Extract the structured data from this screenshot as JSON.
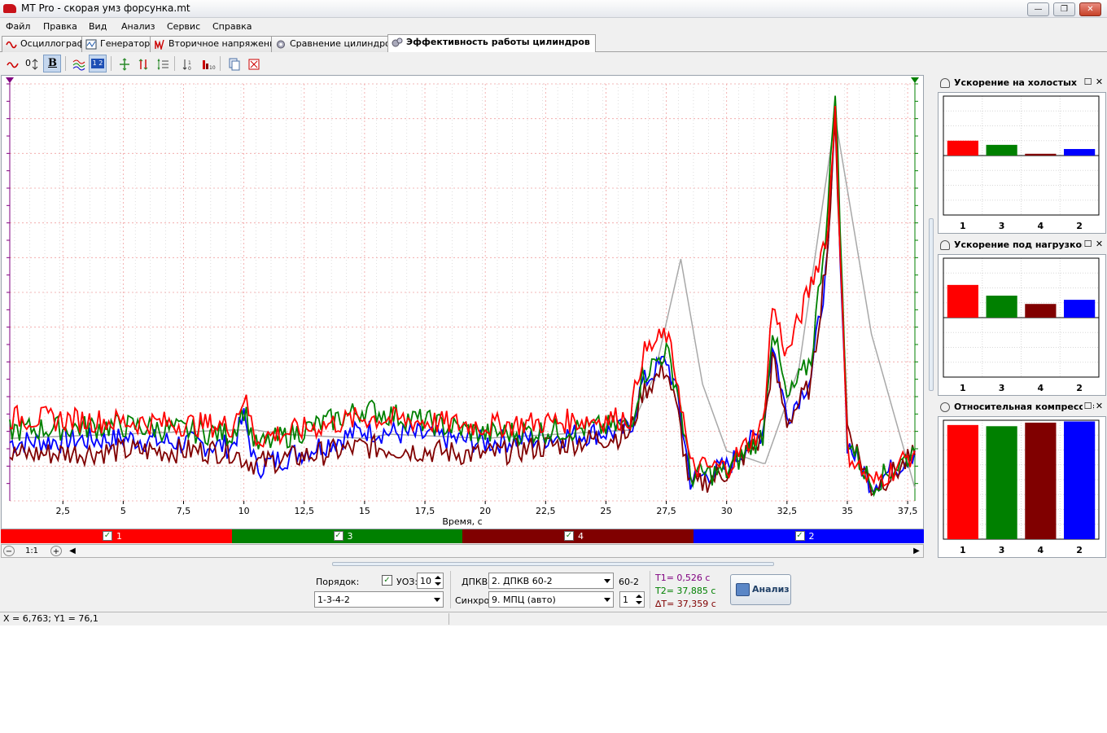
{
  "window": {
    "title": "MT Pro - скорая умз форсунка.mt"
  },
  "menu": [
    "Файл",
    "Правка",
    "Вид",
    "Анализ",
    "Сервис",
    "Справка"
  ],
  "tabs": [
    {
      "label": "Осциллограф",
      "icon": "sine-wave-icon"
    },
    {
      "label": "Генератор",
      "icon": "generator-icon"
    },
    {
      "label": "Вторичное напряжение",
      "icon": "spark-icon"
    },
    {
      "label": "Сравнение цилиндров",
      "icon": "gear-icon"
    },
    {
      "label": "Эффективность работы цилиндров",
      "icon": "gears-icon"
    }
  ],
  "toolbar": {
    "offset_label": "0",
    "bold_label": "B",
    "counter_badge": "1 2"
  },
  "colors": {
    "cyl1": "#ff0000",
    "cyl3": "#008000",
    "cyl4": "#800000",
    "cyl2": "#0000ff",
    "reference": "#a8a8a8",
    "grid": "#f0a0a0",
    "marker_t1": "#800080",
    "marker_t2": "#008000"
  },
  "legend": [
    {
      "label": "1",
      "color": "#ff0000",
      "checked": true
    },
    {
      "label": "3",
      "color": "#008000",
      "checked": true
    },
    {
      "label": "4",
      "color": "#800000",
      "checked": true
    },
    {
      "label": "2",
      "color": "#0000ff",
      "checked": true
    }
  ],
  "scrollbar": {
    "zoom_label": "1:1"
  },
  "chart_data": {
    "type": "line",
    "xlabel": "Время, с",
    "ylabel": "",
    "xlim": [
      0.3,
      37.8
    ],
    "ylim": [
      0,
      100
    ],
    "x_ticks": [
      "2,5",
      "5",
      "7,5",
      "10",
      "12,5",
      "15",
      "17,5",
      "20",
      "22,5",
      "25",
      "27,5",
      "30",
      "32,5",
      "35",
      "37,5"
    ],
    "grid": true,
    "series": [
      {
        "name": "1",
        "x": [
          0.3,
          5,
          9.5,
          10,
          10.5,
          15,
          20,
          26,
          26.5,
          27.5,
          28,
          28.5,
          30,
          31.5,
          31.9,
          32.5,
          33.5,
          34.2,
          34.5,
          35,
          36,
          37,
          37.8
        ],
        "y": [
          20,
          19,
          18,
          25,
          15,
          20,
          18,
          20,
          35,
          40,
          28,
          8,
          8,
          18,
          47,
          35,
          52,
          65,
          95,
          12,
          4,
          8,
          12
        ]
      },
      {
        "name": "3",
        "x": [
          0.3,
          5,
          9.5,
          10,
          10.5,
          15,
          20,
          26,
          26.5,
          27.5,
          28,
          28.5,
          30,
          31.5,
          31.9,
          32.5,
          33.5,
          34.2,
          34.5,
          35,
          36,
          37,
          37.8
        ],
        "y": [
          17,
          18,
          16,
          22,
          13,
          22,
          16,
          18,
          30,
          36,
          26,
          6,
          7,
          16,
          42,
          24,
          34,
          70,
          100,
          15,
          4,
          8,
          12
        ]
      },
      {
        "name": "4",
        "x": [
          0.3,
          5,
          9.5,
          10,
          10.5,
          15,
          20,
          26,
          26.5,
          27.5,
          28,
          28.5,
          30,
          31.5,
          31.9,
          32.5,
          33.5,
          34.2,
          34.5,
          35,
          36,
          37,
          37.8
        ],
        "y": [
          11,
          12,
          12,
          10,
          9,
          13,
          11,
          16,
          26,
          32,
          20,
          3,
          7,
          15,
          34,
          19,
          28,
          62,
          90,
          18,
          3,
          7,
          11
        ]
      },
      {
        "name": "2",
        "x": [
          0.3,
          5,
          9.5,
          10,
          10.5,
          15,
          20,
          26,
          26.5,
          27.5,
          28,
          28.5,
          30,
          31.5,
          31.9,
          32.5,
          33.5,
          34.2,
          34.5,
          35,
          36,
          37,
          37.8
        ],
        "y": [
          14,
          15,
          13,
          20,
          8,
          17,
          14,
          17,
          28,
          34,
          24,
          5,
          8,
          17,
          38,
          20,
          30,
          58,
          92,
          14,
          4,
          8,
          12
        ]
      },
      {
        "x": [
          0.3,
          9.5,
          10.5,
          11.5,
          15,
          16,
          20,
          26,
          27,
          28.1,
          29,
          30,
          31.5,
          31.6,
          33,
          34.5,
          36,
          37.8
        ],
        "y": [
          15,
          17,
          17,
          16,
          15,
          16,
          15,
          17,
          30,
          58,
          28,
          12,
          9,
          9,
          32,
          92,
          40,
          3
        ]
      }
    ],
    "markers": [
      {
        "label": "T1",
        "x": 0.526
      },
      {
        "label": "T2",
        "x": 37.885
      }
    ]
  },
  "side_panels": [
    {
      "title": "Ускорение на холостых",
      "chart_data": {
        "type": "bar",
        "categories": [
          "1",
          "3",
          "4",
          "2"
        ],
        "values": [
          2.5,
          1.8,
          0.3,
          1.1
        ],
        "ylim": [
          -10,
          10
        ]
      }
    },
    {
      "title": "Ускорение под нагрузкой",
      "chart_data": {
        "type": "bar",
        "categories": [
          "1",
          "3",
          "4",
          "2"
        ],
        "values": [
          5.5,
          3.7,
          2.3,
          3.0
        ],
        "ylim": [
          -10,
          10
        ]
      }
    },
    {
      "title": "Относительная компрессия",
      "chart_data": {
        "type": "bar",
        "categories": [
          "1",
          "3",
          "4",
          "2"
        ],
        "values": [
          96,
          95,
          98,
          99
        ],
        "ylim": [
          0,
          100
        ]
      }
    }
  ],
  "controls": {
    "order_label": "Порядок:",
    "order_value": "1-3-4-2",
    "uoz_label": "УОЗ:",
    "uoz_value": "10",
    "dpkv_label": "ДПКВ:",
    "dpkv_value": "2. ДПКВ 60-2",
    "dpkv_suffix": "60-2",
    "sync_label": "Синхро:",
    "sync_value": "9. МПЦ (авто)",
    "sync_channel": "1",
    "t1": "T1= 0,526 с",
    "t2": "T2= 37,885 с",
    "dt": "∆T= 37,359 с",
    "analyze_label": "Анализ"
  },
  "status": {
    "coords": "X = 6,763; Y1 = 76,1"
  }
}
